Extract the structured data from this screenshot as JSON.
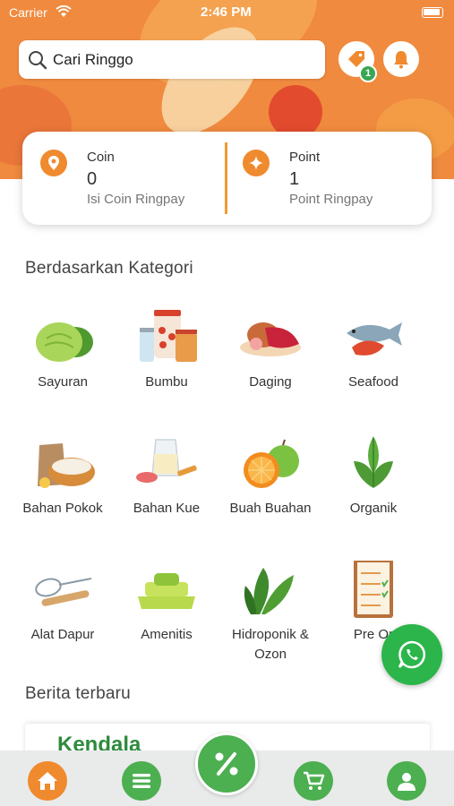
{
  "status_bar": {
    "carrier": "Carrier",
    "time": "2:46 PM"
  },
  "search": {
    "placeholder": "Cari Ringgo"
  },
  "notifications": {
    "voucher_badge_count": "1"
  },
  "wallet": {
    "coin": {
      "title": "Coin",
      "value": "0",
      "subtitle": "Isi Coin Ringpay"
    },
    "point": {
      "title": "Point",
      "value": "1",
      "subtitle": "Point Ringpay"
    }
  },
  "categories": {
    "title": "Berdasarkan Kategori",
    "items": [
      {
        "label": "Sayuran",
        "icon": "cabbage-icon"
      },
      {
        "label": "Bumbu",
        "icon": "spice-jars-icon"
      },
      {
        "label": "Daging",
        "icon": "meat-icon"
      },
      {
        "label": "Seafood",
        "icon": "fish-shrimp-icon"
      },
      {
        "label": "Bahan Pokok",
        "icon": "staples-icon"
      },
      {
        "label": "Bahan Kue",
        "icon": "baking-icon"
      },
      {
        "label": "Buah Buahan",
        "icon": "fruit-icon"
      },
      {
        "label": "Organik",
        "icon": "leaf-icon"
      },
      {
        "label": "Alat Dapur",
        "icon": "kitchen-tools-icon"
      },
      {
        "label": "Amenitis",
        "icon": "towels-icon"
      },
      {
        "label": "Hidroponik & Ozon",
        "icon": "spinach-icon"
      },
      {
        "label": "Pre Or",
        "icon": "clipboard-icon"
      }
    ]
  },
  "news": {
    "title": "Berita terbaru",
    "card_brand": "Kendala"
  },
  "colors": {
    "brand_orange": "#f08a2e",
    "brand_green": "#4caf50",
    "whatsapp_green": "#2bb54a"
  },
  "tabbar": {
    "items": [
      "home-icon",
      "menu-icon",
      "promo-percent-icon",
      "cart-icon",
      "profile-icon"
    ]
  }
}
